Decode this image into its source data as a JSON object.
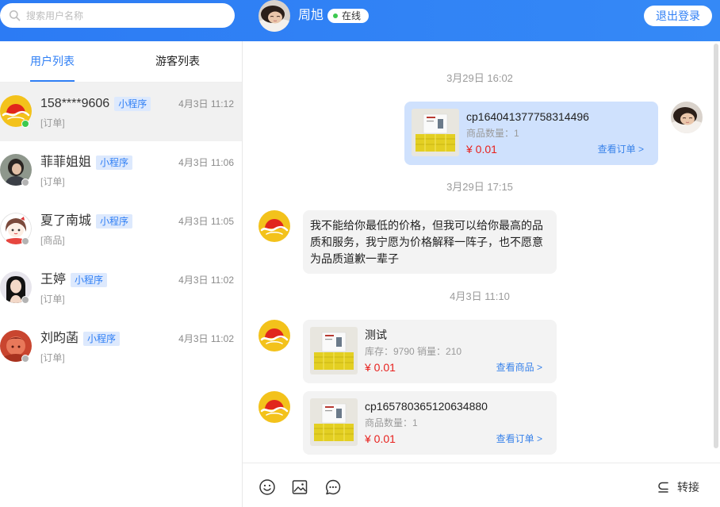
{
  "header": {
    "search_placeholder": "搜索用户名称",
    "agent_name": "周旭",
    "agent_status": "在线",
    "logout_label": "退出登录"
  },
  "tabs": [
    {
      "label": "用户列表",
      "active": true
    },
    {
      "label": "游客列表",
      "active": false
    }
  ],
  "users": [
    {
      "name": "158****9606",
      "tag": "小程序",
      "time": "4月3日 11:12",
      "last": "[订单]",
      "online": true,
      "selected": true
    },
    {
      "name": "菲菲姐姐",
      "tag": "小程序",
      "time": "4月3日 11:06",
      "last": "[订单]",
      "online": false,
      "selected": false
    },
    {
      "name": "夏了南城",
      "tag": "小程序",
      "time": "4月3日 11:05",
      "last": "[商品]",
      "online": false,
      "selected": false
    },
    {
      "name": "王婷",
      "tag": "小程序",
      "time": "4月3日 11:02",
      "last": "[订单]",
      "online": false,
      "selected": false
    },
    {
      "name": "刘昀菡",
      "tag": "小程序",
      "time": "4月3日 11:02",
      "last": "[订单]",
      "online": false,
      "selected": false
    }
  ],
  "chat": {
    "messages": [
      {
        "text": "3月29日 16:02"
      },
      {
        "from_agent": true,
        "title": "cp164041377758314496",
        "detail": "商品数量：1",
        "price": "¥ 0.01",
        "link": "查看订单 >"
      },
      {
        "text": "3月29日 17:15"
      },
      {
        "from_agent": false,
        "text": "我不能给你最低的价格，但我可以给你最高的品质和服务，我宁愿为价格解释一阵子，也不愿意为品质道歉一辈子"
      },
      {
        "text": "4月3日 11:10"
      },
      {
        "from_agent": false,
        "title": "测试",
        "detail": "库存：9790 销量：210",
        "price": "¥ 0.01",
        "link": "查看商品 >"
      },
      {
        "from_agent": false,
        "title": "cp165780365120634880",
        "detail": "商品数量：1",
        "price": "¥ 0.01",
        "link": "查看订单 >"
      }
    ]
  },
  "toolbar": {
    "tools": [
      "emoji-icon",
      "image-icon",
      "chat-icon"
    ],
    "transfer_label": "转接"
  },
  "colors": {
    "primary": "#2f7ff5",
    "online": "#3cc94f",
    "offline": "#b3b3b3",
    "price": "#e8211e",
    "link": "#3a83ea",
    "agent_bubble": "#cfe1fd",
    "customer_bubble": "#f3f3f3",
    "selected_row": "#f1f1f1",
    "tag_bg": "#dde9fd"
  }
}
